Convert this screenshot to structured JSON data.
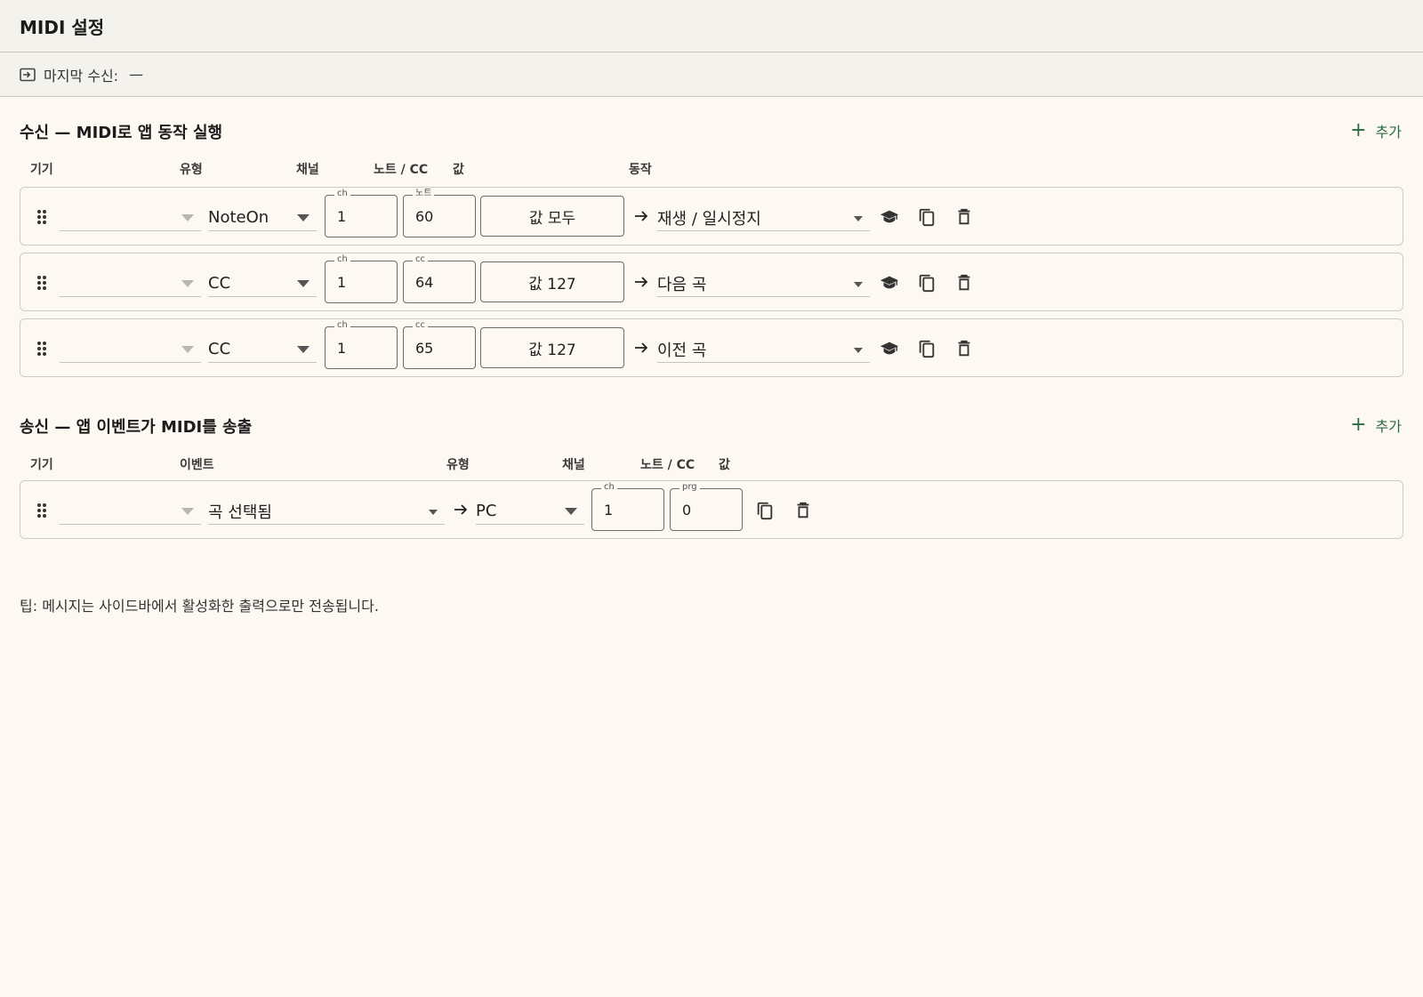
{
  "header": {
    "title": "MIDI 설정"
  },
  "status": {
    "label": "마지막 수신:",
    "value": "—"
  },
  "receive": {
    "title": "수신 — MIDI로 앱 동작 실행",
    "add_label": "추가",
    "columns": {
      "device": "기기",
      "type": "유형",
      "channel": "채널",
      "note_cc": "노트 / CC",
      "value": "값",
      "action": "동작"
    },
    "rows": [
      {
        "device": "",
        "type": "NoteOn",
        "ch_legend": "ch",
        "ch": "1",
        "num_legend": "노트",
        "num": "60",
        "value": "값 모두",
        "action": "재생 / 일시정지"
      },
      {
        "device": "",
        "type": "CC",
        "ch_legend": "ch",
        "ch": "1",
        "num_legend": "cc",
        "num": "64",
        "value": "값 127",
        "action": "다음 곡"
      },
      {
        "device": "",
        "type": "CC",
        "ch_legend": "ch",
        "ch": "1",
        "num_legend": "cc",
        "num": "65",
        "value": "값 127",
        "action": "이전 곡"
      }
    ]
  },
  "send": {
    "title": "송신 — 앱 이벤트가 MIDI를 송출",
    "add_label": "추가",
    "columns": {
      "device": "기기",
      "event": "이벤트",
      "type": "유형",
      "channel": "채널",
      "note_cc": "노트 / CC",
      "value": "값"
    },
    "rows": [
      {
        "device": "",
        "event": "곡 선택됨",
        "type": "PC",
        "ch_legend": "ch",
        "ch": "1",
        "num_legend": "prg",
        "num": "0"
      }
    ]
  },
  "tip": "팁: 메시지는 사이드바에서 활성화한 출력으로만 전송됩니다.",
  "colors": {
    "accent": "#2a6a45",
    "background": "#fdf8f1",
    "bar": "#f4f2ed"
  }
}
